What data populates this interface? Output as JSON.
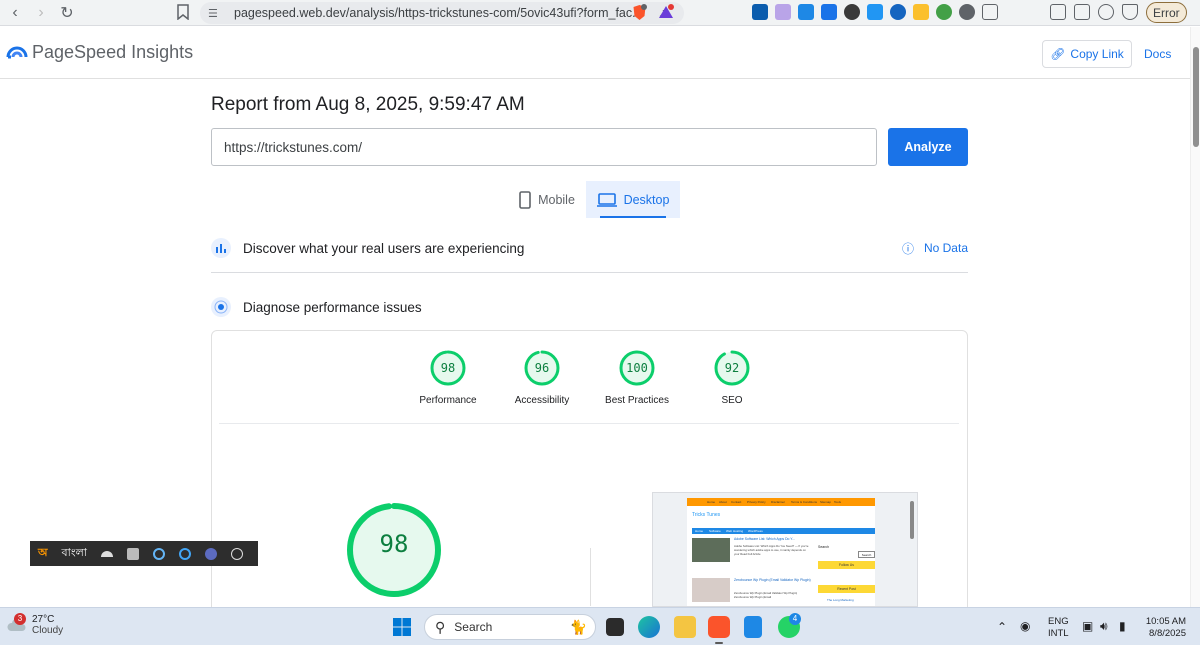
{
  "browser": {
    "address_url": "pagespeed.web.dev/analysis/https-trickstunes-com/5ovic43ufi?form_fac...",
    "error_label": "Error",
    "brave_shield_badge": "2",
    "rewards_badge": "1"
  },
  "header": {
    "app_title": "PageSpeed Insights",
    "copy_link_label": "Copy Link",
    "docs_label": "Docs"
  },
  "report": {
    "title": "Report from Aug 8, 2025, 9:59:47 AM",
    "url_value": "https://trickstunes.com/",
    "analyze_label": "Analyze"
  },
  "tabs": [
    {
      "label": "Mobile",
      "active": false
    },
    {
      "label": "Desktop",
      "active": true
    }
  ],
  "sections": {
    "real_users_label": "Discover what your real users are experiencing",
    "no_data_label": "No Data",
    "diagnose_label": "Diagnose performance issues"
  },
  "scores": [
    {
      "label": "Performance",
      "value": 98
    },
    {
      "label": "Accessibility",
      "value": 96
    },
    {
      "label": "Best Practices",
      "value": 100
    },
    {
      "label": "SEO",
      "value": 92
    }
  ],
  "main_score": {
    "value": 98
  },
  "score_color": "#0cce6b",
  "thumbnail": {
    "site_title": "Tricks Tunes",
    "nav_items": [
      "Home",
      "About",
      "Contact",
      "Privacy Policy",
      "Disclaimer",
      "Terms & Conditions",
      "Sitemap",
      "Tools"
    ],
    "menu_items": [
      "Home",
      "Software",
      "Web Hosting",
      "WordPress"
    ],
    "post1_title": "Adobe Software List: Which Apps Do Y...",
    "post1_excerpt": "Adobe Software List: Which Apps Do You Need? — If you're wondering which adobe apps to use, it mainly depends on your Read Full Article",
    "post2_title": "Zerobounce Wp Plugin (Email Validator Wp Plugin)",
    "post2_excerpt": "Zerobounce Wp Plugin (Email Validator Wp Plugin) Zerobounce Wp Plugin (Email",
    "search_label": "Search",
    "search_button": "Search",
    "follow_label": "Follow Us",
    "recent_label": "Recent Post",
    "recent_item": "The Long Marketing"
  },
  "language_bar": {
    "language": "বাংলা"
  },
  "taskbar": {
    "weather_badge": "3",
    "temperature": "27°C",
    "condition": "Cloudy",
    "search_label": "Search",
    "whatsapp_badge": "4",
    "lang_top": "ENG",
    "lang_bottom": "INTL",
    "time": "10:05 AM",
    "date": "8/8/2025"
  }
}
